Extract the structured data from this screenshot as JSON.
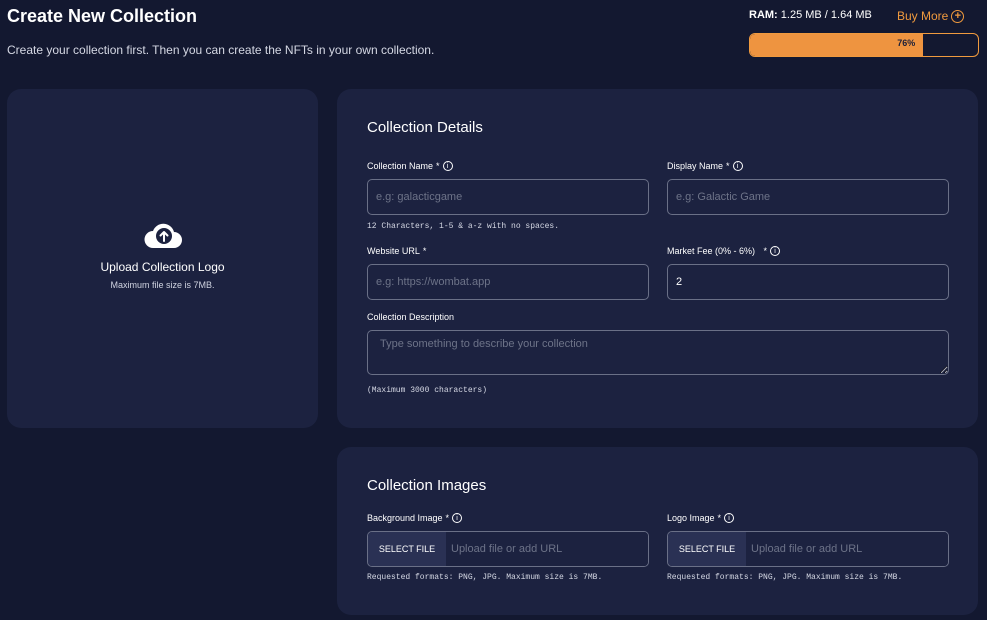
{
  "header": {
    "title": "Create New Collection",
    "subtitle": "Create your collection first. Then you can create the NFTs in your own collection."
  },
  "ram": {
    "label": "RAM:",
    "usage": "1.25 MB / 1.64 MB",
    "percent_text": "76%",
    "percent": 76,
    "buy_more": "Buy More",
    "accent": "#f09a3e"
  },
  "upload": {
    "title": "Upload Collection Logo",
    "subtitle": "Maximum file size is 7MB.",
    "icon": "cloud-upload-icon"
  },
  "details": {
    "title": "Collection Details",
    "collection_name": {
      "label": "Collection Name",
      "placeholder": "e.g: galacticgame",
      "hint": "12 Characters, 1-5 & a-z with no spaces."
    },
    "display_name": {
      "label": "Display Name",
      "placeholder": "e.g: Galactic Game"
    },
    "website_url": {
      "label": "Website URL",
      "placeholder": "e.g: https://wombat.app"
    },
    "market_fee": {
      "label": "Market Fee (0% - 6%)",
      "value": "2"
    },
    "description": {
      "label": "Collection Description",
      "placeholder": "Type something to describe your collection",
      "hint": "(Maximum 3000 characters)"
    }
  },
  "images": {
    "title": "Collection Images",
    "background": {
      "label": "Background Image",
      "button": "SELECT FILE",
      "placeholder": "Upload file or add URL",
      "hint": "Requested formats: PNG, JPG. Maximum size is 7MB."
    },
    "logo": {
      "label": "Logo Image",
      "button": "SELECT FILE",
      "placeholder": "Upload file or add URL",
      "hint": "Requested formats: PNG, JPG. Maximum size is 7MB."
    }
  },
  "common": {
    "asterisk": "*",
    "info_icon_glyph": "i"
  }
}
